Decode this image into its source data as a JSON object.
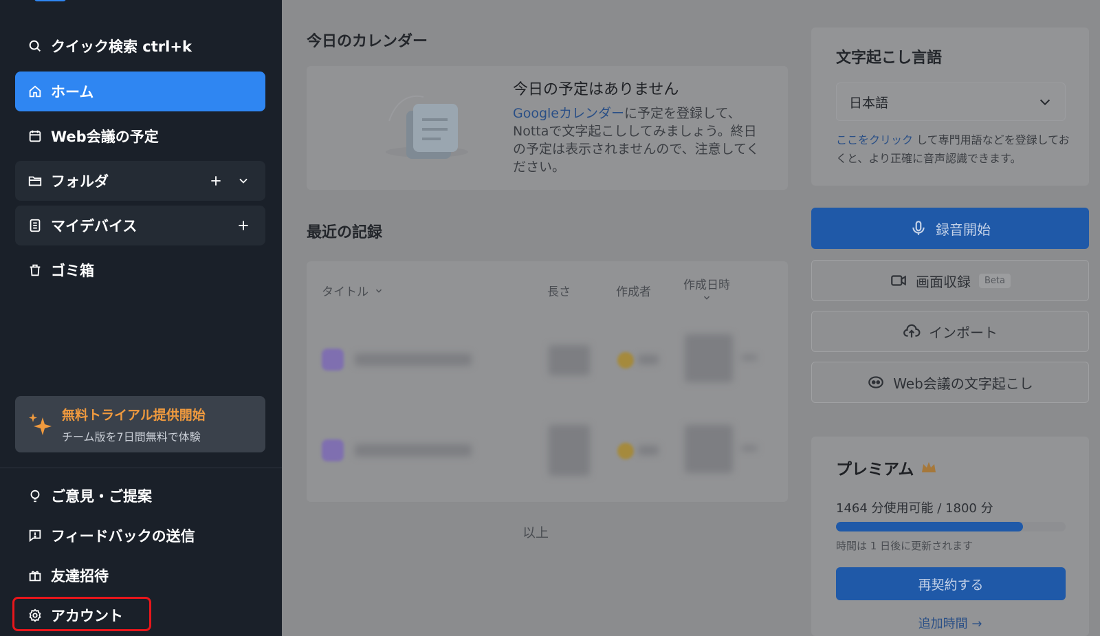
{
  "sidebar": {
    "quick_search": "クイック検索 ctrl+k",
    "home": "ホーム",
    "web_meetings": "Web会議の予定",
    "folders": "フォルダ",
    "my_devices": "マイデバイス",
    "trash": "ゴミ箱",
    "trial": {
      "title": "無料トライアル提供開始",
      "subtitle": "チーム版を7日間無料で体験"
    },
    "feedback_suggest": "ご意見・ご提案",
    "send_feedback": "フィードバックの送信",
    "invite_friends": "友達招待",
    "account": "アカウント"
  },
  "calendar": {
    "section_title": "今日のカレンダー",
    "empty_title": "今日の予定はありません",
    "desc_link": "Googleカレンダー",
    "desc_rest": "に予定を登録して、Nottaで文字起こししてみましょう。終日の予定は表示されませんので、注意してください。"
  },
  "records": {
    "section_title": "最近の記録",
    "columns": {
      "title": "タイトル",
      "length": "長さ",
      "creator": "作成者",
      "created_at": "作成日時"
    },
    "end_label": "以上"
  },
  "language": {
    "section_title": "文字起こし言語",
    "selected": "日本語",
    "note_link": "ここをクリック",
    "note_rest": "して専門用語などを登録しておくと、より正確に音声認識できます。"
  },
  "actions": {
    "record": "録音開始",
    "screen_record": "画面収録",
    "beta": "Beta",
    "import": "インポート",
    "web_meeting_transcribe": "Web会議の文字起こし"
  },
  "premium": {
    "title": "プレミアム",
    "usage": "1464 分使用可能 / 1800 分",
    "usage_fraction": 0.813,
    "reset_note": "時間は 1 日後に更新されます",
    "renew": "再契約する",
    "add_time": "追加時間 →"
  },
  "colors": {
    "sidebar_bg": "#1a2029",
    "active_blue": "#2f86f2",
    "trial_orange": "#f09a3e",
    "highlight_red": "#e8161b",
    "overlay_gray": "#8b8c8e"
  }
}
